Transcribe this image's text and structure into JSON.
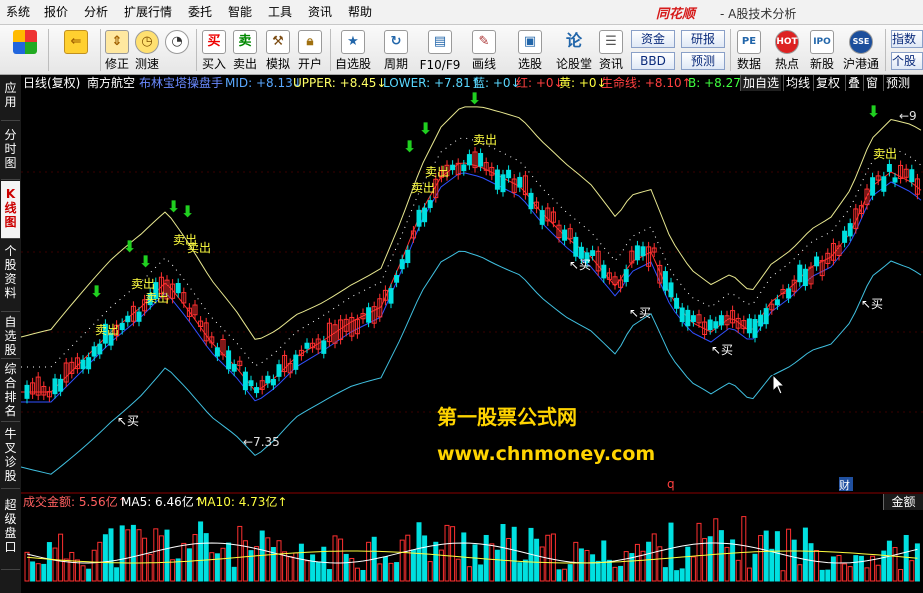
{
  "menubar": {
    "items": [
      "系统",
      "报价",
      "分析",
      "扩展行情",
      "委托",
      "智能",
      "工具",
      "资讯",
      "帮助"
    ],
    "brand": "同花顺",
    "app_title": "- A股技术分析"
  },
  "toolbar": {
    "buttons": [
      {
        "label": "",
        "icon": "app-grid-icon"
      },
      {
        "label": "",
        "icon": "back-arrow-icon"
      },
      {
        "label": "修正",
        "icon": "updown-arrows-icon"
      },
      {
        "label": "测速",
        "icon": "clock-icon"
      },
      {
        "label": "买入",
        "icon": "buy-icon",
        "glyph": "买"
      },
      {
        "label": "卖出",
        "icon": "sell-icon",
        "glyph": "卖"
      },
      {
        "label": "模拟",
        "icon": "hammer-icon"
      },
      {
        "label": "开户",
        "icon": "lock-icon"
      },
      {
        "label": "自选股",
        "icon": "star-icon"
      },
      {
        "label": "周期",
        "icon": "cycle-icon"
      },
      {
        "label": "F10/F9",
        "icon": "f10-icon"
      },
      {
        "label": "画线",
        "icon": "pencil-icon"
      },
      {
        "label": "选股",
        "icon": "screen-icon"
      },
      {
        "label": "论股堂",
        "icon": "forum-icon"
      },
      {
        "label": "资讯",
        "icon": "news-icon"
      },
      {
        "label": "数据",
        "icon": "pe-icon",
        "glyph": "PE"
      },
      {
        "label": "热点",
        "icon": "hot-icon"
      },
      {
        "label": "新股",
        "icon": "ipo-icon",
        "glyph": "IPO"
      },
      {
        "label": "沪港通",
        "icon": "hk-icon"
      },
      {
        "label": "指数",
        "icon": "index-icon"
      }
    ],
    "small_buttons": [
      "资金",
      "研报",
      "BBD",
      "预测"
    ]
  },
  "left_tabs": [
    "应用",
    "分时图",
    "K线图",
    "个股资料",
    "自选股",
    "综合排名",
    "牛叉诊股",
    "超级盘口"
  ],
  "active_left_tab": "K线图",
  "infobar": {
    "period": "日线(复权)",
    "stock": "南方航空",
    "indicator": "布林宝塔操盘手",
    "mid": "MID: +8.13↓",
    "upper": "UPPER: +8.45↓",
    "lower": "LOWER: +7.81↑",
    "blue": "蓝: +0↓",
    "red": "红: +0↓",
    "yellow": "黄: +0↓",
    "lifeline": "生命线: +8.10↑",
    "b": "B: +8.27↑",
    "right_tabs": [
      "加自选",
      "均线",
      "复权",
      "叠",
      "窗",
      "预测"
    ]
  },
  "chart_data": {
    "type": "candlestick",
    "min_label": "←7.35",
    "max_label": "←9",
    "annotations_sell": "卖出",
    "annotations_buy": "买",
    "watermark_title": "第一股票公式网",
    "watermark_url": "www.chnmoney.com",
    "marker_q": "q",
    "marker_cai": "财",
    "colors": {
      "up": "#ff3030",
      "down": "#00e0e0",
      "upper": "#e8e890",
      "lower": "#40c0e0",
      "mid": "#3050ff",
      "life": "#ff3030",
      "dots": "#ffffff",
      "sell_arrow": "#20d020",
      "buy_text": "#ffffff",
      "annot_sell": "#ffff40"
    }
  },
  "volume": {
    "title": "成交金额: 5.56亿↑",
    "ma5": "MA5: 6.46亿↑",
    "ma10": "MA10: 4.73亿↑",
    "tab": "金额"
  }
}
